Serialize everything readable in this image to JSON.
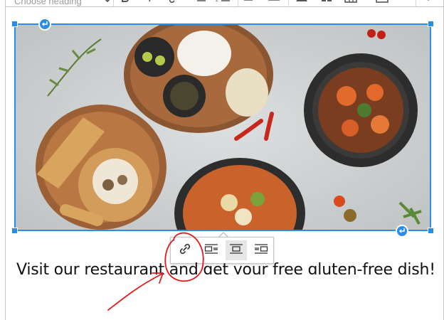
{
  "toolbar": {
    "heading_placeholder": "Choose heading",
    "icons": [
      "bold-icon",
      "italic-icon",
      "link-icon",
      "bulleted-list-icon",
      "numbered-list-icon",
      "align-left-icon",
      "align-right-icon",
      "image-icon",
      "block-icon",
      "table-icon",
      "media-icon",
      "more-icon"
    ]
  },
  "image": {
    "alt": "Food dishes on a table",
    "selected": true,
    "accent_color": "#2a8ee6"
  },
  "image_toolbar": {
    "buttons": [
      {
        "name": "link",
        "icon": "link-icon",
        "active": false
      },
      {
        "name": "align-left",
        "icon": "image-align-left-icon",
        "active": false
      },
      {
        "name": "align-center",
        "icon": "image-align-center-icon",
        "active": true
      },
      {
        "name": "align-right",
        "icon": "image-align-right-icon",
        "active": false
      }
    ]
  },
  "content": {
    "heading": "Visit our restaurant and get your free gluten-free dish!"
  },
  "annotation": {
    "color": "#e01b1b"
  }
}
